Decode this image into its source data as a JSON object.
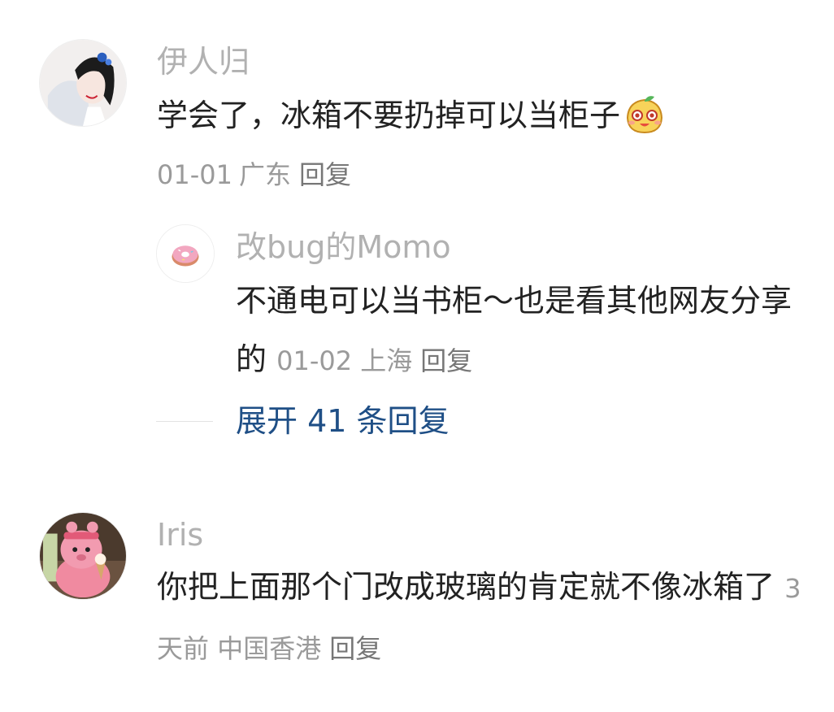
{
  "comments": [
    {
      "username": "伊人归",
      "text": "学会了，冰箱不要扔掉可以当柜子",
      "emoji_icon": "smiling-mango-emoji-icon",
      "date": "01-01",
      "location": "广东",
      "reply_label": "回复",
      "replies": [
        {
          "username": "改bug的Momo",
          "text": "不通电可以当书柜～也是看其他网友分享的",
          "date": "01-02",
          "location": "上海",
          "reply_label": "回复"
        }
      ],
      "expand_label": "展开 41 条回复"
    },
    {
      "username": "Iris",
      "text": "你把上面那个门改成玻璃的肯定就不像冰箱了",
      "date": "3天前",
      "location": "中国香港",
      "reply_label": "回复"
    }
  ],
  "colors": {
    "username": "#b1b1b1",
    "text": "#222222",
    "meta": "#9a9a9a",
    "link": "#1f4f86"
  }
}
